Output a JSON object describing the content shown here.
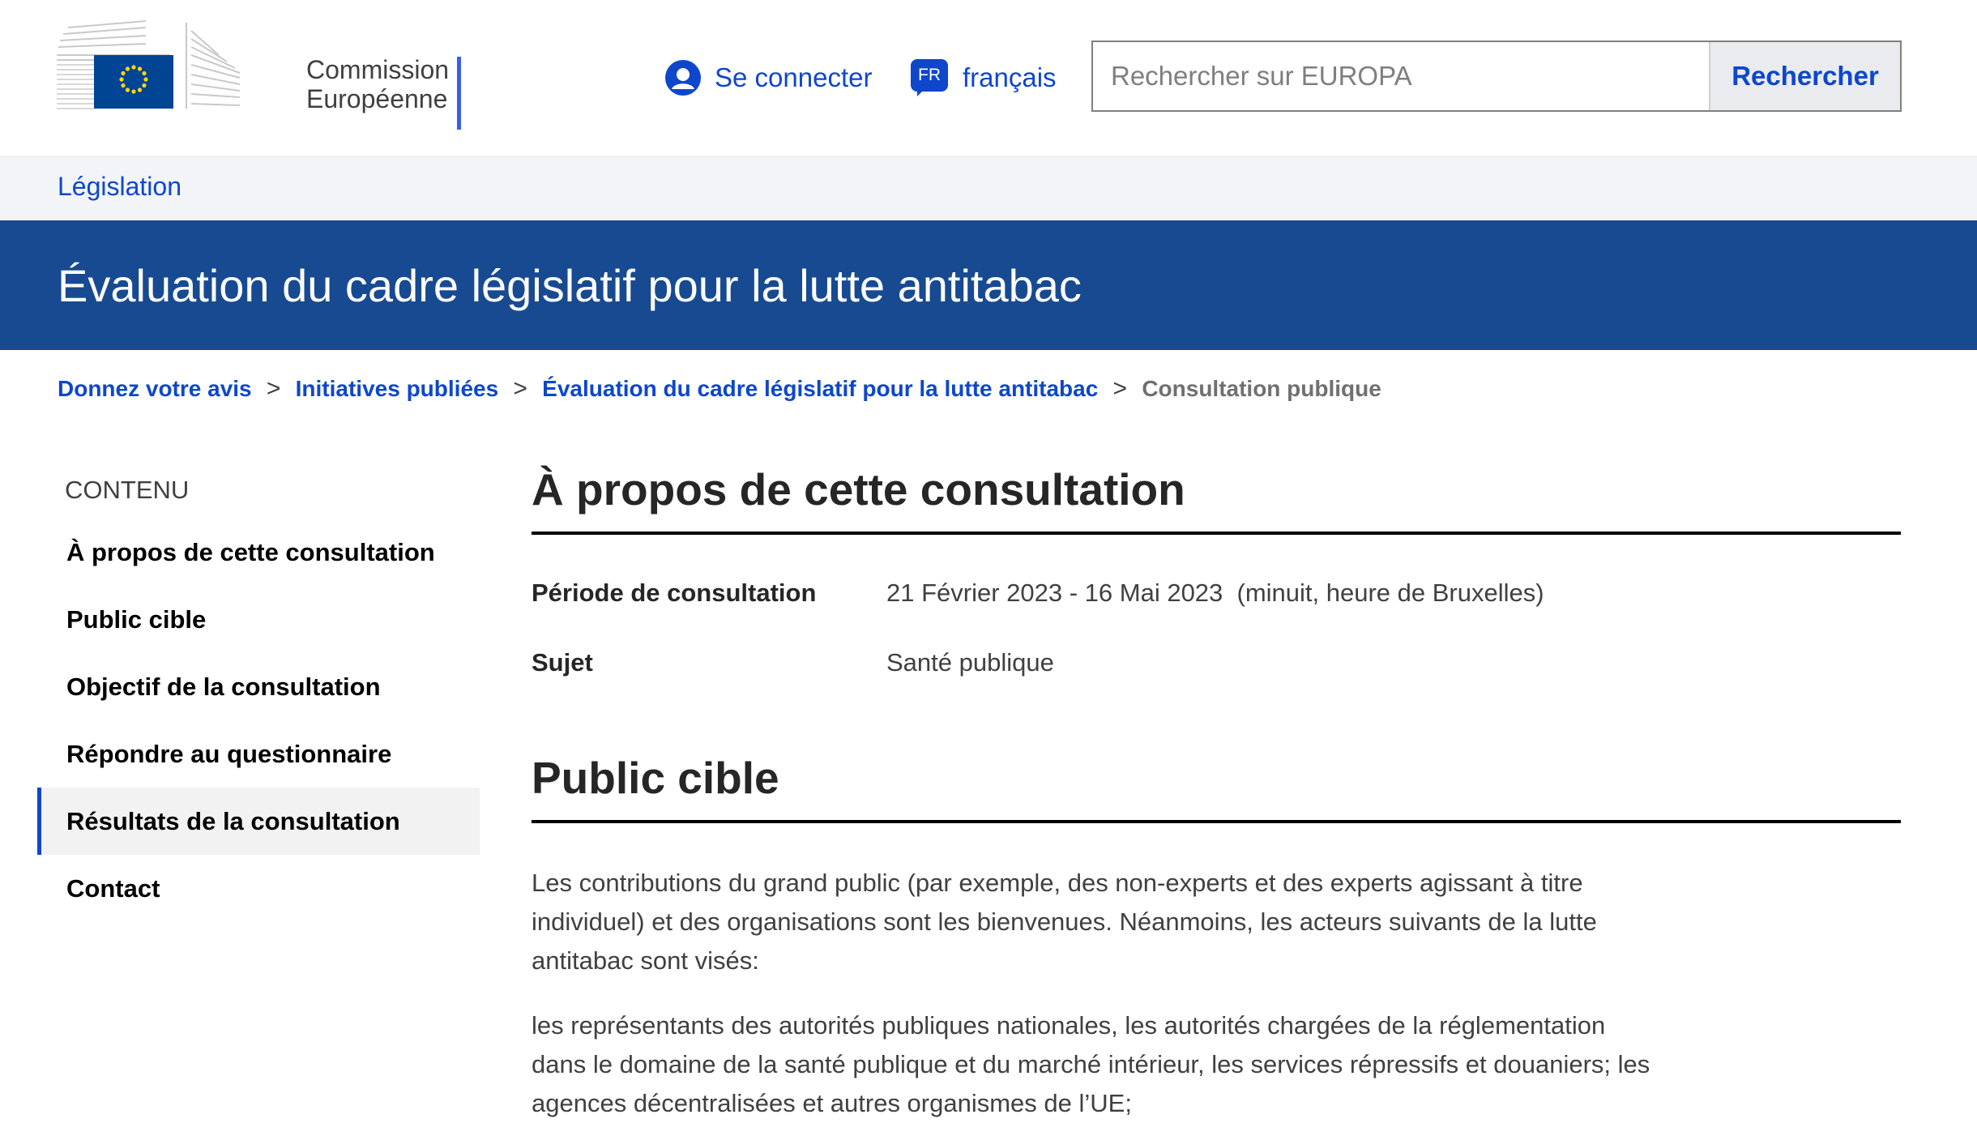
{
  "header": {
    "logo_line1": "Commission",
    "logo_line2": "Européenne",
    "login_label": "Se connecter",
    "lang_code": "FR",
    "lang_label": "français",
    "search_placeholder": "Rechercher sur EUROPA",
    "search_value": "",
    "search_button": "Rechercher"
  },
  "site_bar": {
    "label": "Législation"
  },
  "page_title": "Évaluation du cadre législatif pour la lutte antitabac",
  "breadcrumb": [
    {
      "label": "Donnez votre avis"
    },
    {
      "label": "Initiatives publiées"
    },
    {
      "label": "Évaluation du cadre législatif pour la lutte antitabac"
    },
    {
      "label": "Consultation publique"
    }
  ],
  "breadcrumb_separator": ">",
  "sidebar": {
    "title": "CONTENU",
    "items": [
      {
        "label": "À propos de cette consultation"
      },
      {
        "label": "Public cible"
      },
      {
        "label": "Objectif de la consultation"
      },
      {
        "label": "Répondre au questionnaire"
      },
      {
        "label": "Résultats de la consultation",
        "active": true
      },
      {
        "label": "Contact"
      }
    ]
  },
  "main": {
    "about": {
      "heading": "À propos de cette consultation",
      "period_label": "Période de consultation",
      "period_value": "21 Février 2023 - 16 Mai 2023  (minuit, heure de Bruxelles)",
      "subject_label": "Sujet",
      "subject_value": "Santé publique"
    },
    "audience": {
      "heading": "Public cible",
      "paragraph1": "Les contributions du grand public (par exemple, des non-experts et des experts agissant à titre individuel) et des organisations sont les bienvenues. Néanmoins, les acteurs suivants de la lutte antitabac sont visés:",
      "paragraph2": "les représentants des autorités publiques nationales, les autorités chargées de la réglementation dans le domaine de la santé publique et du marché intérieur, les services répressifs et douaniers; les agences décentralisées et autres organismes de l’UE;"
    }
  },
  "colors": {
    "brand_blue": "#174a91",
    "link_blue": "#0e47cb",
    "eu_flag_blue": "#004494",
    "eu_star_yellow": "#ffd617",
    "site_bar_bg": "#f2f4f7"
  }
}
